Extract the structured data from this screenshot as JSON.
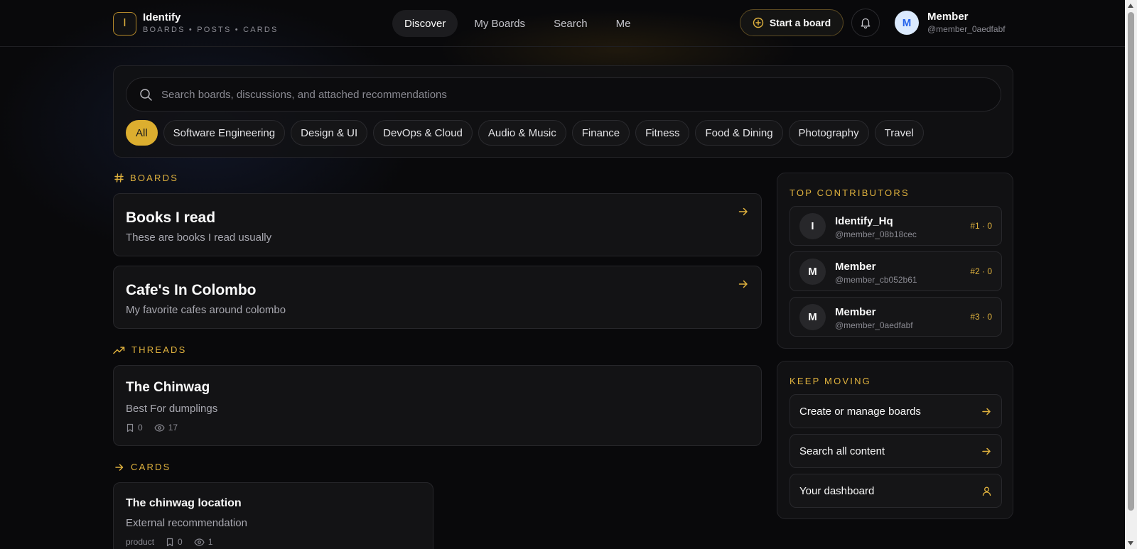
{
  "brand": {
    "mark": "I",
    "name": "Identify",
    "tagline": "BOARDS • POSTS • CARDS"
  },
  "nav": {
    "items": [
      "Discover",
      "My Boards",
      "Search",
      "Me"
    ],
    "active": "Discover"
  },
  "header": {
    "start_board_label": "Start a board",
    "user_initial": "M",
    "user_name": "Member",
    "user_handle": "@member_0aedfabf"
  },
  "search": {
    "placeholder": "Search boards, discussions, and attached recommendations",
    "value": ""
  },
  "categories": [
    "All",
    "Software Engineering",
    "Design & UI",
    "DevOps & Cloud",
    "Audio & Music",
    "Finance",
    "Fitness",
    "Food & Dining",
    "Photography",
    "Travel"
  ],
  "sections": {
    "boards": "BOARDS",
    "threads": "THREADS",
    "cards": "CARDS"
  },
  "boards": [
    {
      "title": "Books I read",
      "description": "These are books I read usually"
    },
    {
      "title": "Cafe's In Colombo",
      "description": "My favorite cafes around colombo"
    }
  ],
  "threads": [
    {
      "title": "The Chinwag",
      "description": "Best For dumplings",
      "saves": "0",
      "views": "17"
    }
  ],
  "cards": [
    {
      "title": "The chinwag location",
      "description": "External recommendation",
      "tag": "product",
      "saves": "0",
      "views": "1"
    }
  ],
  "sidebar": {
    "top_contributors_title": "TOP CONTRIBUTORS",
    "contributors": [
      {
        "initial": "I",
        "name": "Identify_Hq",
        "handle": "@member_08b18cec",
        "rank": "#1 · 0"
      },
      {
        "initial": "M",
        "name": "Member",
        "handle": "@member_cb052b61",
        "rank": "#2 · 0"
      },
      {
        "initial": "M",
        "name": "Member",
        "handle": "@member_0aedfabf",
        "rank": "#3 · 0"
      }
    ],
    "keep_moving_title": "KEEP MOVING",
    "links": [
      "Create or manage boards",
      "Search all content",
      "Your dashboard"
    ]
  },
  "colors": {
    "accent": "#e0b23e",
    "background": "#09090b",
    "card": "#131315",
    "avatar_bg": "#dbeafe"
  }
}
